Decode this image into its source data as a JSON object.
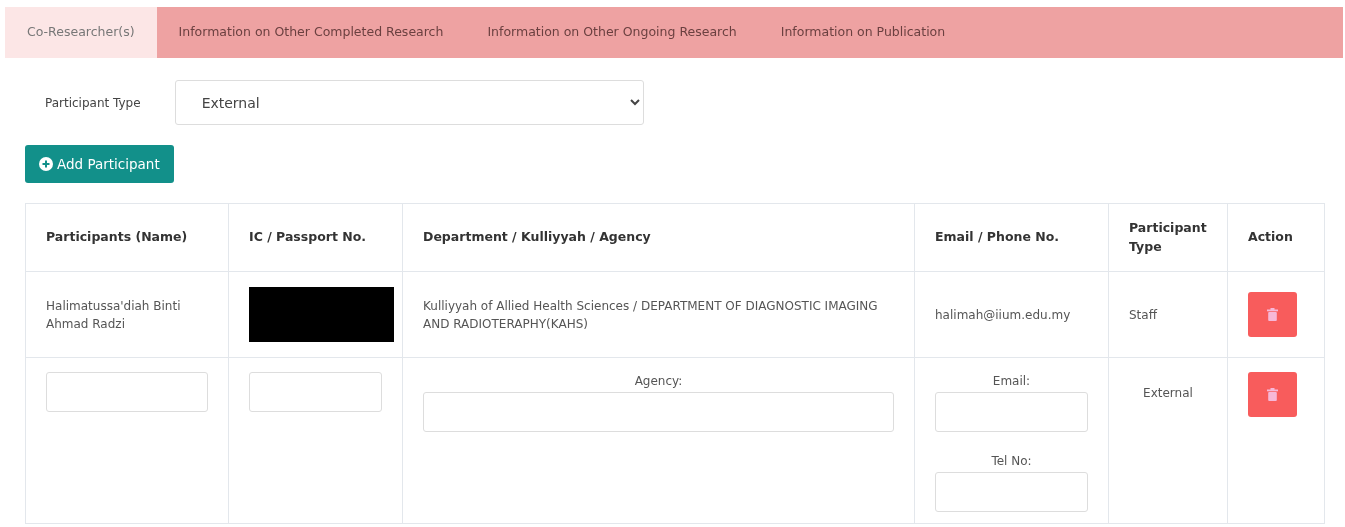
{
  "tabs": [
    {
      "label": "Co-Researcher(s)",
      "selected": true
    },
    {
      "label": "Information on Other Completed Research",
      "selected": false
    },
    {
      "label": "Information on Other Ongoing Research",
      "selected": false
    },
    {
      "label": "Information on Publication",
      "selected": false
    }
  ],
  "participant_type": {
    "label": "Participant Type",
    "value": "External"
  },
  "add_button": "Add Participant",
  "table": {
    "columns": [
      "Participants (Name)",
      "IC / Passport No.",
      "Department / Kulliyyah / Agency",
      "Email / Phone No.",
      "Participant Type",
      "Action"
    ],
    "rows": [
      {
        "kind": "existing",
        "name": "Halimatussa'diah Binti Ahmad Radzi",
        "ic_redacted": true,
        "department": "Kulliyyah of Allied Health Sciences / DEPARTMENT OF DIAGNOSTIC IMAGING AND RADIOTERAPHY(KAHS)",
        "email": "halimah@iium.edu.my",
        "type": "Staff"
      },
      {
        "kind": "new",
        "agency_label": "Agency:",
        "email_label": "Email:",
        "tel_label": "Tel No:",
        "type": "External"
      }
    ]
  }
}
